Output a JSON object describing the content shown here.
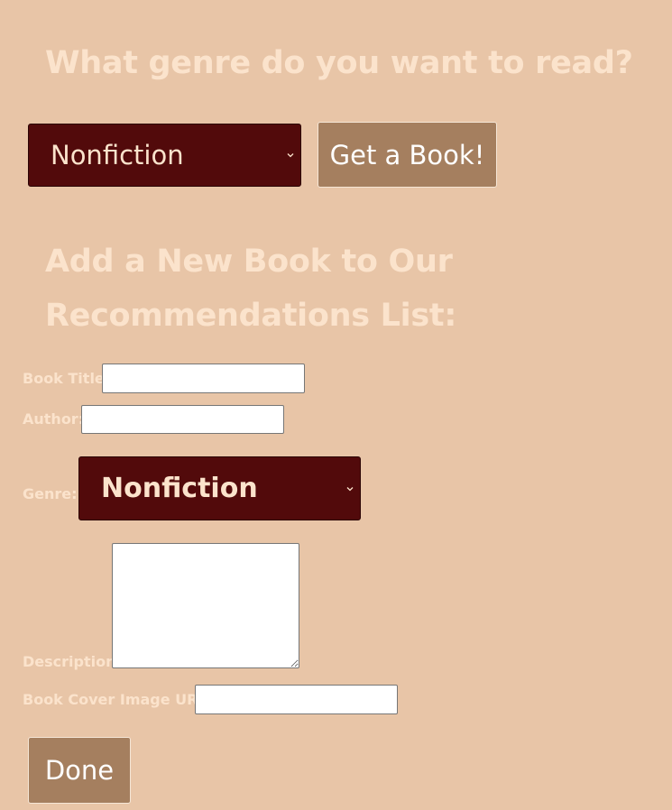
{
  "finder": {
    "heading": "What genre do you want to read?",
    "genre_select": {
      "selected": "Nonfiction"
    },
    "submit_label": "Get a Book!"
  },
  "add_form": {
    "heading_line1": "Add a New Book to Our",
    "heading_line2": "Recommendations List:",
    "title_label": "Book Title:",
    "title_value": "",
    "author_label": "Author:",
    "author_value": "",
    "genre_label": "Genre:",
    "genre_select": {
      "selected": "Nonfiction"
    },
    "description_label": "Description:",
    "description_value": "",
    "cover_label": "Book Cover Image URL:",
    "cover_value": "",
    "done_label": "Done"
  },
  "colors": {
    "background": "#e8c5a7",
    "heading_text": "#fbe3cc",
    "select_bg": "#520a0b",
    "button_bg": "#a57f5f"
  },
  "icons": {
    "select_arrow": "chevron-down-icon"
  }
}
